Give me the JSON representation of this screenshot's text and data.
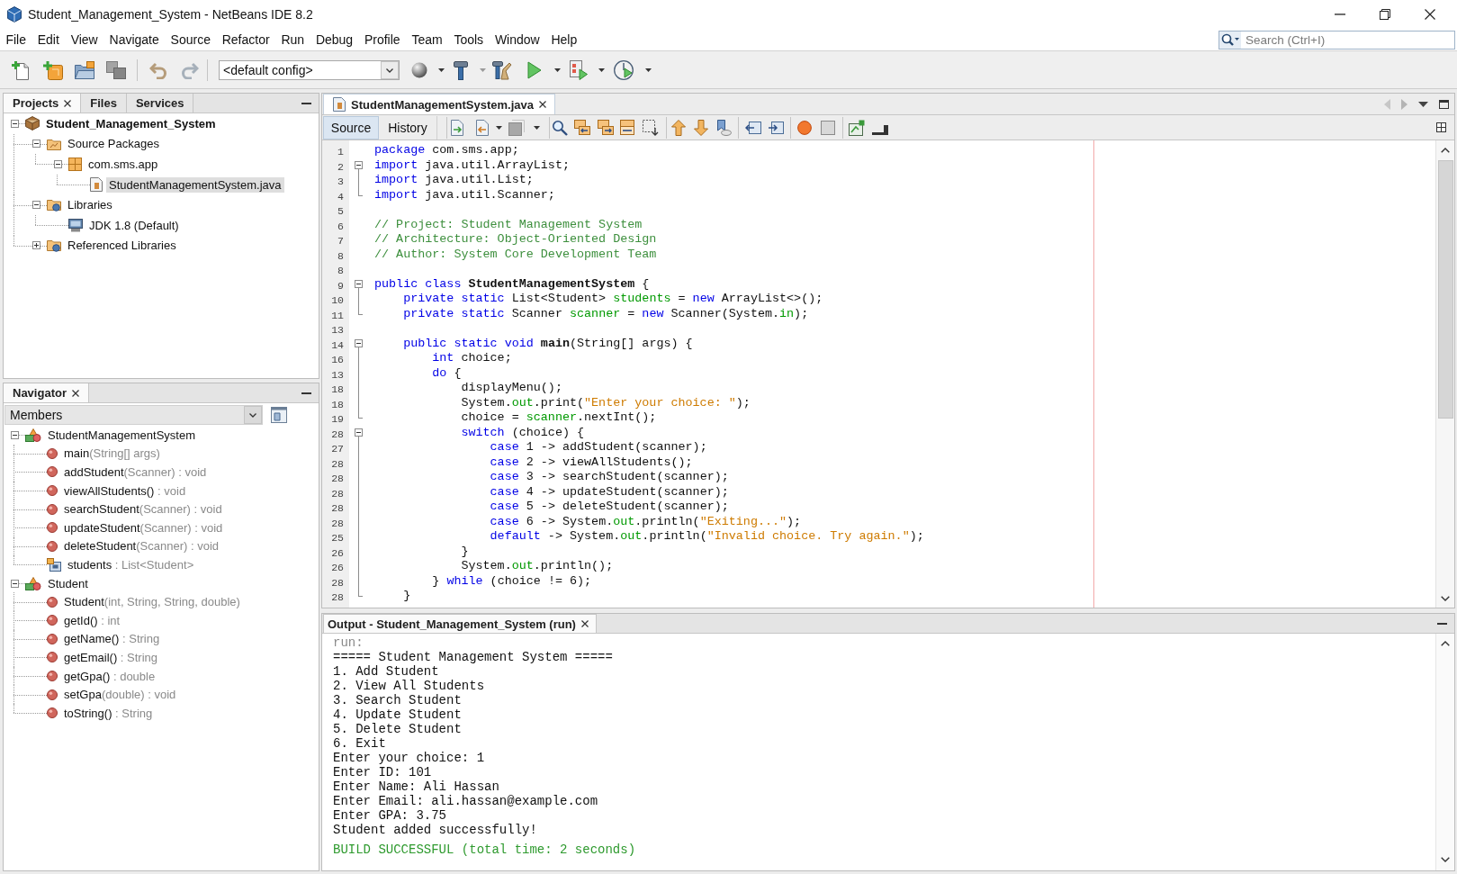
{
  "window": {
    "title": "Student_Management_System - NetBeans IDE 8.2"
  },
  "menu": [
    "File",
    "Edit",
    "View",
    "Navigate",
    "Source",
    "Refactor",
    "Run",
    "Debug",
    "Profile",
    "Team",
    "Tools",
    "Window",
    "Help"
  ],
  "search": {
    "placeholder": "Search (Ctrl+I)"
  },
  "toolbar": {
    "config": "<default config>"
  },
  "projects_panel": {
    "tabs": [
      {
        "label": "Projects",
        "selected": true,
        "closable": true
      },
      {
        "label": "Files",
        "selected": false,
        "closable": false
      },
      {
        "label": "Services",
        "selected": false,
        "closable": false
      }
    ],
    "tree": [
      {
        "label": "Student_Management_System",
        "kind": "project",
        "expanded": true,
        "selected": false,
        "children": [
          {
            "label": "Source Packages",
            "kind": "source-folder",
            "expanded": true,
            "selected": false,
            "children": [
              {
                "label": "com.sms.app",
                "kind": "package",
                "expanded": true,
                "selected": false,
                "children": [
                  {
                    "label": "StudentManagementSystem.java",
                    "kind": "java-file",
                    "selected": true
                  }
                ]
              }
            ]
          },
          {
            "label": "Libraries",
            "kind": "library-folder",
            "expanded": true,
            "selected": false,
            "children": [
              {
                "label": "JDK 1.8 (Default)",
                "kind": "jdk",
                "selected": false
              }
            ]
          },
          {
            "label": "Referenced Libraries",
            "kind": "library-folder",
            "expanded": false,
            "selected": false
          }
        ]
      }
    ]
  },
  "navigator": {
    "tab": {
      "label": "Navigator",
      "selected": true,
      "closable": true
    },
    "filter": "Members",
    "tree": [
      {
        "name": "StudentManagementSystem",
        "kind": "class",
        "expanded": true,
        "selected": false,
        "children": [
          {
            "name": "main",
            "detail": "(String[] args)",
            "kind": "method",
            "selected": false
          },
          {
            "name": "addStudent",
            "detail": "(Scanner) : void",
            "kind": "method",
            "selected": false
          },
          {
            "name": "viewAllStudents()",
            "detail": " : void",
            "kind": "method",
            "selected": false
          },
          {
            "name": "searchStudent",
            "detail": "(Scanner) : void",
            "kind": "method",
            "selected": false
          },
          {
            "name": "updateStudent",
            "detail": "(Scanner) : void",
            "kind": "method",
            "selected": false
          },
          {
            "name": "deleteStudent",
            "detail": "(Scanner) : void",
            "kind": "method",
            "selected": false
          },
          {
            "name": "students",
            "detail": " : List<Student>",
            "kind": "field",
            "selected": false
          }
        ]
      },
      {
        "name": "Student",
        "kind": "class",
        "expanded": true,
        "selected": false,
        "children": [
          {
            "name": "Student",
            "detail": "(int, String, String, double)",
            "kind": "method",
            "selected": false
          },
          {
            "name": "getId()",
            "detail": " : int",
            "kind": "method",
            "selected": false
          },
          {
            "name": "getName()",
            "detail": " : String",
            "kind": "method",
            "selected": false
          },
          {
            "name": "getEmail()",
            "detail": " : String",
            "kind": "method",
            "selected": false
          },
          {
            "name": "getGpa()",
            "detail": " : double",
            "kind": "method",
            "selected": false
          },
          {
            "name": "setGpa",
            "detail": "(double) : void",
            "kind": "method",
            "selected": false
          },
          {
            "name": "toString()",
            "detail": " : String",
            "kind": "method",
            "selected": false
          }
        ]
      }
    ]
  },
  "editor": {
    "tab": {
      "label": "StudentManagementSystem.java",
      "selected": true,
      "closable": true
    },
    "views": [
      {
        "label": "Source",
        "selected": true
      },
      {
        "label": "History",
        "selected": false
      }
    ],
    "lines": [
      {
        "number": "1",
        "kind": "plain",
        "tokens": [
          {
            "kind": "keyword",
            "text": "package"
          },
          {
            "kind": "plain",
            "text": " com.sms.app;"
          }
        ]
      },
      {
        "number": "2",
        "kind": "fold-open",
        "tokens": [
          {
            "kind": "keyword",
            "text": "import"
          },
          {
            "kind": "plain",
            "text": " java.util.ArrayList;"
          }
        ]
      },
      {
        "number": "3",
        "kind": "fold-body",
        "tokens": [
          {
            "kind": "keyword",
            "text": "import"
          },
          {
            "kind": "plain",
            "text": " java.util.List;"
          }
        ]
      },
      {
        "number": "4",
        "kind": "fold-end",
        "tokens": [
          {
            "kind": "keyword",
            "text": "import"
          },
          {
            "kind": "plain",
            "text": " java.util.Scanner;"
          }
        ]
      },
      {
        "number": "5",
        "kind": "plain"
      },
      {
        "number": "6",
        "kind": "plain",
        "tokens": [
          {
            "kind": "comment",
            "text": "// Project: Student Management System"
          }
        ]
      },
      {
        "number": "7",
        "kind": "plain",
        "tokens": [
          {
            "kind": "comment",
            "text": "// Architecture: Object-Oriented Design"
          }
        ]
      },
      {
        "number": "8",
        "kind": "plain",
        "tokens": [
          {
            "kind": "comment",
            "text": "// Author: System Core Development Team"
          }
        ]
      },
      {
        "number": "8",
        "kind": "plain"
      },
      {
        "number": "9",
        "kind": "fold-open",
        "tokens": [
          {
            "kind": "keyword",
            "text": "public class "
          },
          {
            "kind": "declaration",
            "text": "StudentManagementSystem"
          },
          {
            "kind": "plain",
            "text": " {"
          }
        ]
      },
      {
        "number": "10",
        "kind": "fold-body",
        "tokens": [
          {
            "kind": "keyword",
            "text": "    private static"
          },
          {
            "kind": "plain",
            "text": " List<Student> "
          },
          {
            "kind": "field",
            "text": "students"
          },
          {
            "kind": "plain",
            "text": " = "
          },
          {
            "kind": "keyword",
            "text": "new"
          },
          {
            "kind": "plain",
            "text": " ArrayList<>();"
          }
        ]
      },
      {
        "number": "11",
        "kind": "fold-end",
        "tokens": [
          {
            "kind": "keyword",
            "text": "    private static"
          },
          {
            "kind": "plain",
            "text": " Scanner "
          },
          {
            "kind": "field",
            "text": "scanner"
          },
          {
            "kind": "plain",
            "text": " = "
          },
          {
            "kind": "keyword",
            "text": "new"
          },
          {
            "kind": "plain",
            "text": " Scanner(System."
          },
          {
            "kind": "field",
            "text": "in"
          },
          {
            "kind": "plain",
            "text": ");"
          }
        ]
      },
      {
        "number": "13",
        "kind": "plain"
      },
      {
        "number": "14",
        "kind": "fold-open",
        "tokens": [
          {
            "kind": "keyword",
            "text": "    public static void "
          },
          {
            "kind": "declaration",
            "text": "main"
          },
          {
            "kind": "plain",
            "text": "(String[] args) {"
          }
        ]
      },
      {
        "number": "16",
        "kind": "fold-body",
        "tokens": [
          {
            "kind": "keyword",
            "text": "        int"
          },
          {
            "kind": "plain",
            "text": " choice;"
          }
        ]
      },
      {
        "number": "13",
        "kind": "fold-body",
        "tokens": [
          {
            "kind": "keyword",
            "text": "        do"
          },
          {
            "kind": "plain",
            "text": " {"
          }
        ]
      },
      {
        "number": "18",
        "kind": "fold-body",
        "tokens": [
          {
            "kind": "plain",
            "text": "            displayMenu();"
          }
        ]
      },
      {
        "number": "18",
        "kind": "fold-body",
        "tokens": [
          {
            "kind": "plain",
            "text": "            System."
          },
          {
            "kind": "field",
            "text": "out"
          },
          {
            "kind": "plain",
            "text": ".print("
          },
          {
            "kind": "string",
            "text": "\"Enter your choice: \""
          },
          {
            "kind": "plain",
            "text": ");"
          }
        ]
      },
      {
        "number": "19",
        "kind": "fold-end",
        "tokens": [
          {
            "kind": "plain",
            "text": "            choice = "
          },
          {
            "kind": "field",
            "text": "scanner"
          },
          {
            "kind": "plain",
            "text": ".nextInt();"
          }
        ]
      },
      {
        "number": "28",
        "kind": "fold-open",
        "tokens": [
          {
            "kind": "keyword",
            "text": "            switch"
          },
          {
            "kind": "plain",
            "text": " (choice) {"
          }
        ]
      },
      {
        "number": "27",
        "kind": "fold-body",
        "tokens": [
          {
            "kind": "keyword",
            "text": "                case"
          },
          {
            "kind": "plain",
            "text": " 1 -> addStudent(scanner);"
          }
        ]
      },
      {
        "number": "28",
        "kind": "fold-body",
        "tokens": [
          {
            "kind": "keyword",
            "text": "                case"
          },
          {
            "kind": "plain",
            "text": " 2 -> viewAllStudents();"
          }
        ]
      },
      {
        "number": "28",
        "kind": "fold-body",
        "tokens": [
          {
            "kind": "keyword",
            "text": "                case"
          },
          {
            "kind": "plain",
            "text": " 3 -> searchStudent(scanner);"
          }
        ]
      },
      {
        "number": "28",
        "kind": "fold-body",
        "tokens": [
          {
            "kind": "keyword",
            "text": "                case"
          },
          {
            "kind": "plain",
            "text": " 4 -> updateStudent(scanner);"
          }
        ]
      },
      {
        "number": "28",
        "kind": "fold-body",
        "tokens": [
          {
            "kind": "keyword",
            "text": "                case"
          },
          {
            "kind": "plain",
            "text": " 5 -> deleteStudent(scanner);"
          }
        ]
      },
      {
        "number": "28",
        "kind": "fold-body",
        "tokens": [
          {
            "kind": "keyword",
            "text": "                case"
          },
          {
            "kind": "plain",
            "text": " 6 -> System."
          },
          {
            "kind": "field",
            "text": "out"
          },
          {
            "kind": "plain",
            "text": ".println("
          },
          {
            "kind": "string",
            "text": "\"Exiting...\""
          },
          {
            "kind": "plain",
            "text": ");"
          }
        ]
      },
      {
        "number": "25",
        "kind": "fold-body",
        "tokens": [
          {
            "kind": "keyword",
            "text": "                default"
          },
          {
            "kind": "plain",
            "text": " -> System."
          },
          {
            "kind": "field",
            "text": "out"
          },
          {
            "kind": "plain",
            "text": ".println("
          },
          {
            "kind": "string",
            "text": "\"Invalid choice. Try again.\""
          },
          {
            "kind": "plain",
            "text": ");"
          }
        ]
      },
      {
        "number": "26",
        "kind": "fold-body",
        "tokens": [
          {
            "kind": "plain",
            "text": "            }"
          }
        ]
      },
      {
        "number": "26",
        "kind": "fold-body",
        "tokens": [
          {
            "kind": "plain",
            "text": "            System."
          },
          {
            "kind": "field",
            "text": "out"
          },
          {
            "kind": "plain",
            "text": ".println();"
          }
        ]
      },
      {
        "number": "28",
        "kind": "fold-body",
        "tokens": [
          {
            "kind": "plain",
            "text": "        } "
          },
          {
            "kind": "keyword",
            "text": "while"
          },
          {
            "kind": "plain",
            "text": " (choice != 6);"
          }
        ]
      },
      {
        "number": "28",
        "kind": "fold-end",
        "tokens": [
          {
            "kind": "plain",
            "text": "    }"
          }
        ]
      }
    ]
  },
  "output": {
    "tab": {
      "label": "Output - Student_Management_System (run)",
      "selected": true,
      "closable": true
    },
    "lines": [
      {
        "kind": "info",
        "text": "run:"
      },
      {
        "kind": "plain",
        "text": "===== Student Management System ====="
      },
      {
        "kind": "plain",
        "text": "1. Add Student"
      },
      {
        "kind": "plain",
        "text": "2. View All Students"
      },
      {
        "kind": "plain",
        "text": "3. Search Student"
      },
      {
        "kind": "plain",
        "text": "4. Update Student"
      },
      {
        "kind": "plain",
        "text": "5. Delete Student"
      },
      {
        "kind": "plain",
        "text": "6. Exit"
      },
      {
        "kind": "plain",
        "text": "Enter your choice: 1"
      },
      {
        "kind": "plain",
        "text": "Enter ID: 101"
      },
      {
        "kind": "plain",
        "text": "Enter Name: Ali Hassan"
      },
      {
        "kind": "plain",
        "text": "Enter Email: ali.hassan@example.com"
      },
      {
        "kind": "plain",
        "text": "Enter GPA: 3.75"
      },
      {
        "kind": "plain",
        "text": "Student added successfully!"
      },
      {
        "kind": "success",
        "text": "BUILD SUCCESSFUL (total time: 2 seconds)"
      }
    ]
  }
}
